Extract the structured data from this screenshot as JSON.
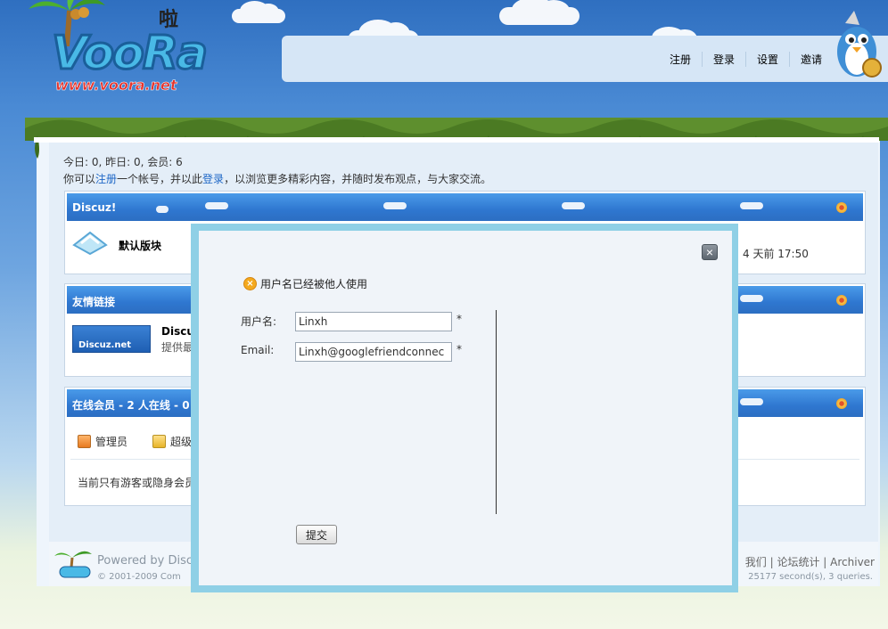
{
  "header": {
    "logo_text": "VooRa",
    "logo_url_text": "www.voora.net",
    "logo_cn": "啦",
    "nav": [
      "注册",
      "登录",
      "设置",
      "邀请"
    ]
  },
  "stats": {
    "counts": "今日: 0, 昨日: 0, 会员: 6",
    "prefix": "你可以",
    "register_link": "注册",
    "middle": "一个帐号，并以此",
    "login_link": "登录",
    "suffix": "，以浏览更多精彩内容，并随时发布观点，与大家交流。"
  },
  "forum_box": {
    "title": "Discuz!",
    "forum_name": "默认版块",
    "last_post": "4 天前 17:50"
  },
  "links_box": {
    "title": "友情链接",
    "logo_label": "Discuz.net",
    "link_title": "Discu",
    "link_desc": "提供最"
  },
  "online_box": {
    "title": "在线会员 - 2 人在线 - 0",
    "legend": [
      "管理员",
      "超级"
    ],
    "note": "当前只有游客或隐身会员"
  },
  "footer": {
    "powered": "Powered by Disc",
    "copyright": "© 2001-2009 Com",
    "links": [
      "我们",
      "论坛统计",
      "Archiver"
    ],
    "queries": "25177 second(s), 3 queries."
  },
  "dialog": {
    "error": "用户名已经被他人使用",
    "username_label": "用户名:",
    "username_value": "Linxh",
    "email_label": "Email:",
    "email_value": "Linxh@googlefriendconnec",
    "required": "*",
    "submit": "提交",
    "close": "×"
  },
  "colors": {
    "sky_top": "#2f6fc0",
    "header_bar": "#2f77d0",
    "link": "#1e67c6",
    "dialog_border": "#8fd0e6"
  }
}
